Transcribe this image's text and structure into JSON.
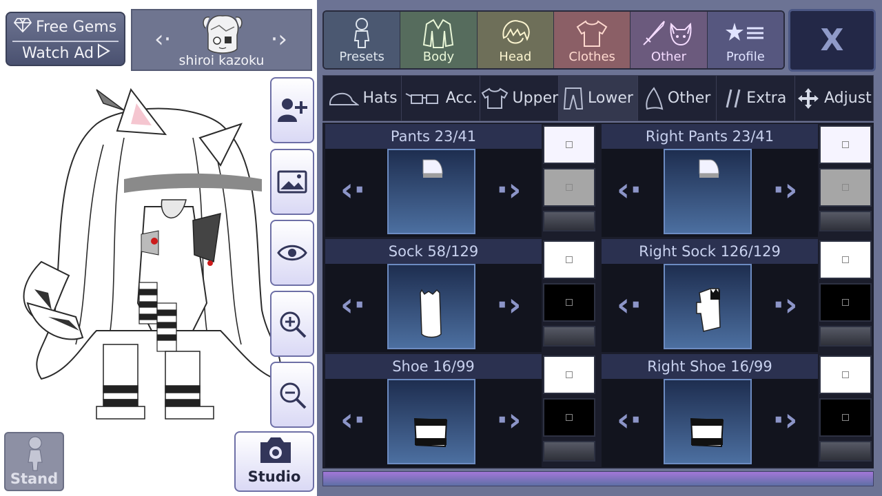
{
  "ad": {
    "free_gems": "Free Gems",
    "watch_ad": "Watch Ad"
  },
  "character": {
    "name": "shiroi kazoku"
  },
  "main_tabs": [
    {
      "label": "Presets",
      "icon": "person-icon"
    },
    {
      "label": "Body",
      "icon": "jacket-icon"
    },
    {
      "label": "Head",
      "icon": "hair-icon"
    },
    {
      "label": "Clothes",
      "icon": "shirt-icon"
    },
    {
      "label": "Other",
      "icon": "sword-cat-icon"
    },
    {
      "label": "Profile",
      "icon": "star-list-icon"
    }
  ],
  "close_label": "X",
  "sub_tabs": [
    {
      "label": "Hats",
      "icon": "cap-icon",
      "active": false
    },
    {
      "label": "Acc.",
      "icon": "glasses-icon",
      "active": false
    },
    {
      "label": "Upper",
      "icon": "tshirt-icon",
      "active": false
    },
    {
      "label": "Lower",
      "icon": "pants-icon",
      "active": true
    },
    {
      "label": "Other",
      "icon": "shard-icon",
      "active": false
    },
    {
      "label": "Extra",
      "icon": "slashes-icon",
      "active": false
    },
    {
      "label": "Adjust",
      "icon": "move-icon",
      "active": false
    }
  ],
  "cards": [
    {
      "title": "Pants 23/41",
      "item": "pants",
      "color1": "#f6f4ff",
      "color2": "#a6a6a6"
    },
    {
      "title": "Right Pants 23/41",
      "item": "pants",
      "color1": "#f6f4ff",
      "color2": "#a6a6a6"
    },
    {
      "title": "Sock 58/129",
      "item": "sock",
      "color1": "#ffffff",
      "color2": "#000000"
    },
    {
      "title": "Right Sock 126/129",
      "item": "sock-right",
      "color1": "#ffffff",
      "color2": "#000000"
    },
    {
      "title": "Shoe 16/99",
      "item": "shoe",
      "color1": "#ffffff",
      "color2": "#000000"
    },
    {
      "title": "Right Shoe 16/99",
      "item": "shoe",
      "color1": "#ffffff",
      "color2": "#000000"
    }
  ],
  "buttons": {
    "stand": "Stand",
    "studio": "Studio"
  },
  "colors": {
    "panel": "#6c7394",
    "card_bg": "#12141e",
    "accent": "#8c95c8"
  }
}
